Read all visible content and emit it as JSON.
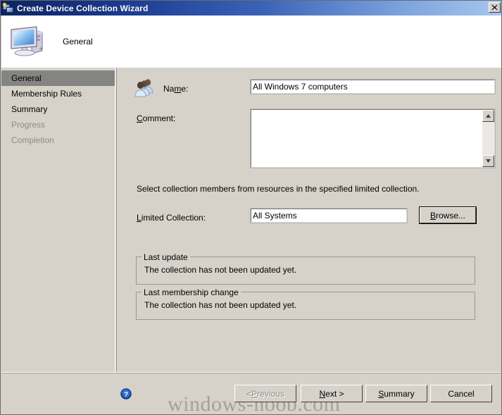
{
  "window": {
    "title": "Create Device Collection Wizard",
    "title_icon": "collection-wizard-icon",
    "close_label": "✕"
  },
  "header": {
    "title": "General",
    "icon": "computer-icon"
  },
  "sidebar": {
    "items": [
      {
        "label": "General",
        "state": "selected"
      },
      {
        "label": "Membership Rules",
        "state": "enabled"
      },
      {
        "label": "Summary",
        "state": "enabled"
      },
      {
        "label": "Progress",
        "state": "disabled"
      },
      {
        "label": "Completion",
        "state": "disabled"
      }
    ]
  },
  "form": {
    "users_icon": "users-group-icon",
    "name_label_pre": "Na",
    "name_label_accel": "m",
    "name_label_post": "e:",
    "name_value": "All Windows 7 computers",
    "name_placeholder": "",
    "comment_label_accel": "C",
    "comment_label_post": "omment:",
    "comment_value": "",
    "comment_placeholder": "",
    "description": "Select collection members from resources in the specified limited collection.",
    "limited_label_accel": "L",
    "limited_label_post": "imited Collection:",
    "limited_value": "All Systems",
    "browse_label_accel": "B",
    "browse_label_post": "rowse...",
    "scroll_up_glyph": "▲",
    "scroll_down_glyph": "▼"
  },
  "groups": [
    {
      "title": "Last update",
      "text": "The collection has not been updated yet."
    },
    {
      "title": "Last membership change",
      "text": "The collection has not been updated yet."
    }
  ],
  "footer": {
    "help_icon": "help-question-icon",
    "buttons": [
      {
        "pre": "< ",
        "accel": "P",
        "post": "revious",
        "state": "disabled"
      },
      {
        "pre": "",
        "accel": "N",
        "post": "ext >",
        "state": "default"
      },
      {
        "pre": "",
        "accel": "S",
        "post": "ummary",
        "state": "enabled"
      },
      {
        "pre": "",
        "accel": "",
        "post": "Cancel",
        "state": "enabled"
      }
    ]
  },
  "watermark": "windows-noob.com",
  "colors": {
    "face": "#d6d2ca",
    "title_dark": "#0c2461",
    "title_light": "#a9c7ee",
    "selection": "#848484",
    "disabled_text": "#8b8b87",
    "watermark": "#a4a19b"
  }
}
